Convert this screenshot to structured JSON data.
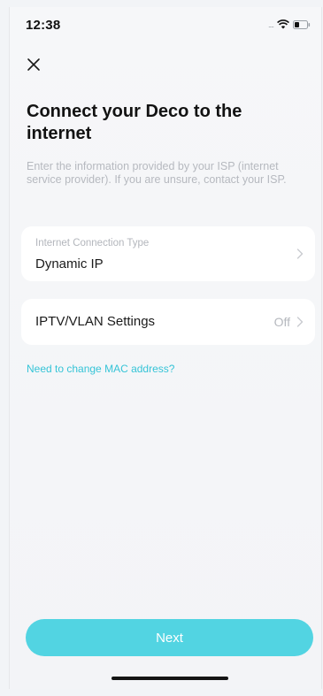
{
  "status_bar": {
    "time": "12:38",
    "signal": "....",
    "icons": [
      "wifi-icon",
      "battery-icon"
    ]
  },
  "header": {
    "close_icon": "close-icon",
    "title": "Connect your Deco to the internet",
    "description": "Enter the information provided by your ISP (internet service provider). If you are unsure, contact your ISP."
  },
  "connection_type": {
    "label": "Internet Connection Type",
    "value": "Dynamic IP",
    "icon": "chevron-right-icon"
  },
  "iptv": {
    "label": "IPTV/VLAN Settings",
    "status": "Off",
    "icon": "chevron-right-icon"
  },
  "mac_link": "Need to change MAC address?",
  "next_button": "Next",
  "colors": {
    "accent": "#52d4e2",
    "link": "#35c4d7",
    "background": "#f3f4f7",
    "card": "#ffffff"
  }
}
